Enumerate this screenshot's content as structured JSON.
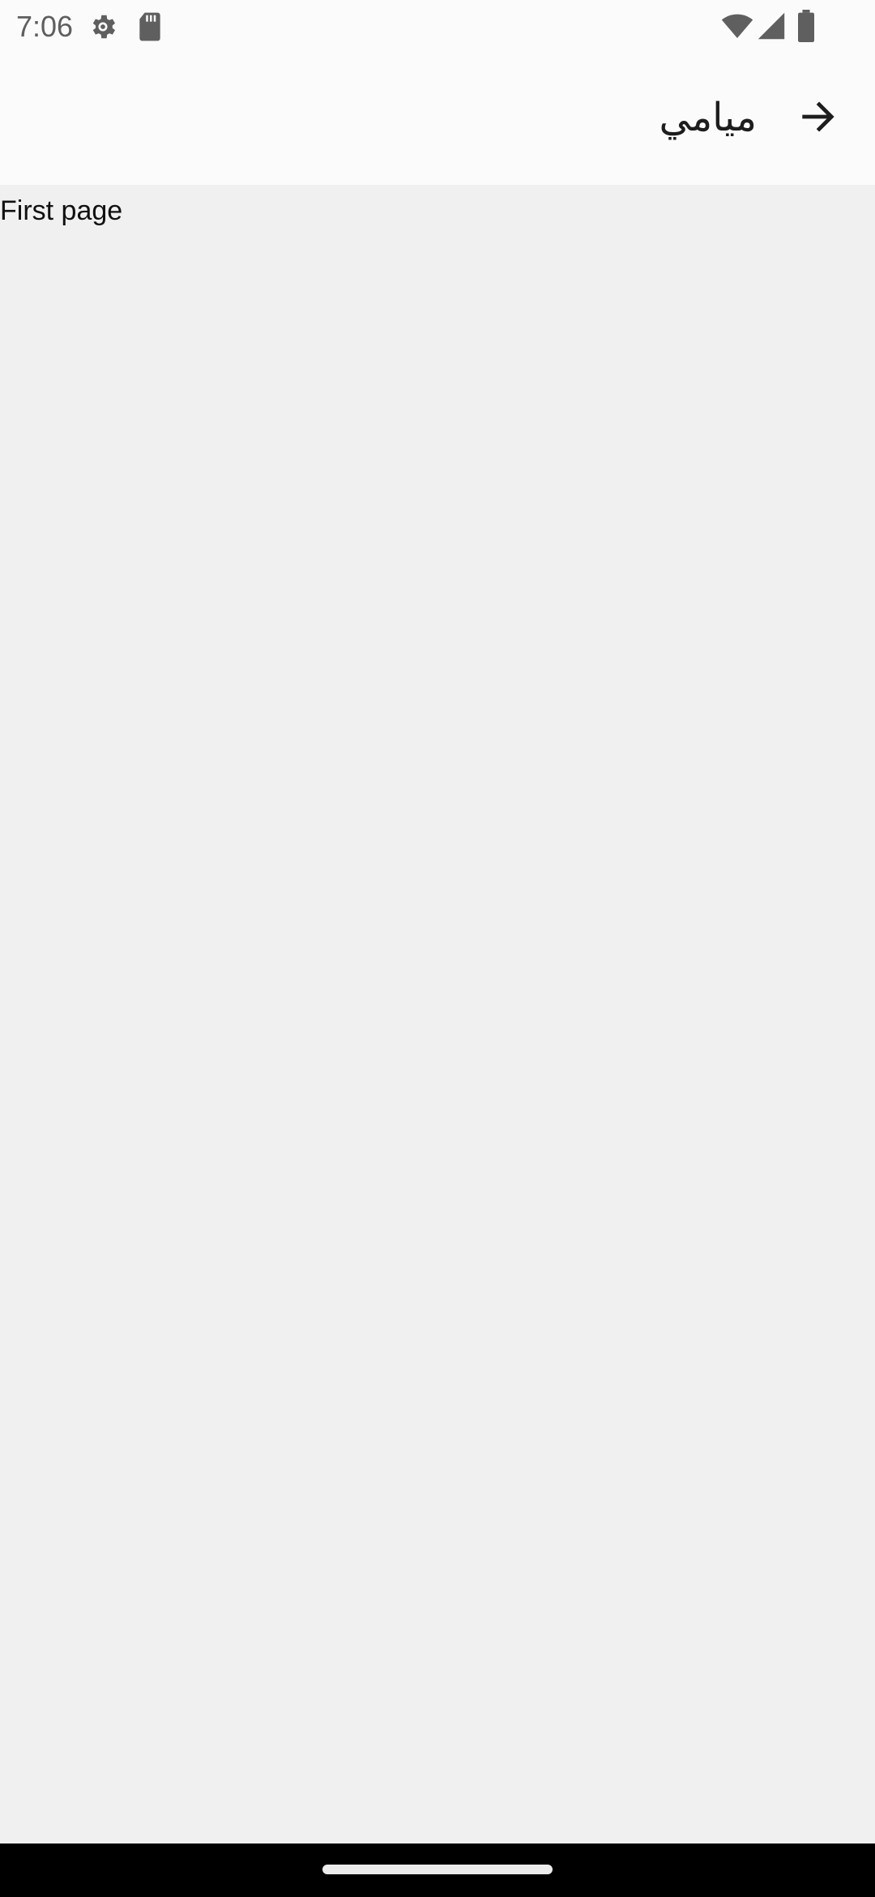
{
  "status_bar": {
    "time": "7:06",
    "icons": [
      "settings-icon",
      "sd-card-icon",
      "wifi-icon",
      "cellular-signal-icon",
      "battery-icon"
    ]
  },
  "app_bar": {
    "title": "ميامي",
    "back_icon": "arrow-right-icon"
  },
  "content": {
    "text": "First page"
  },
  "colors": {
    "app_bar_background": "#fbfbfb",
    "content_background": "#f0f0f0",
    "nav_bar_background": "#000000"
  }
}
